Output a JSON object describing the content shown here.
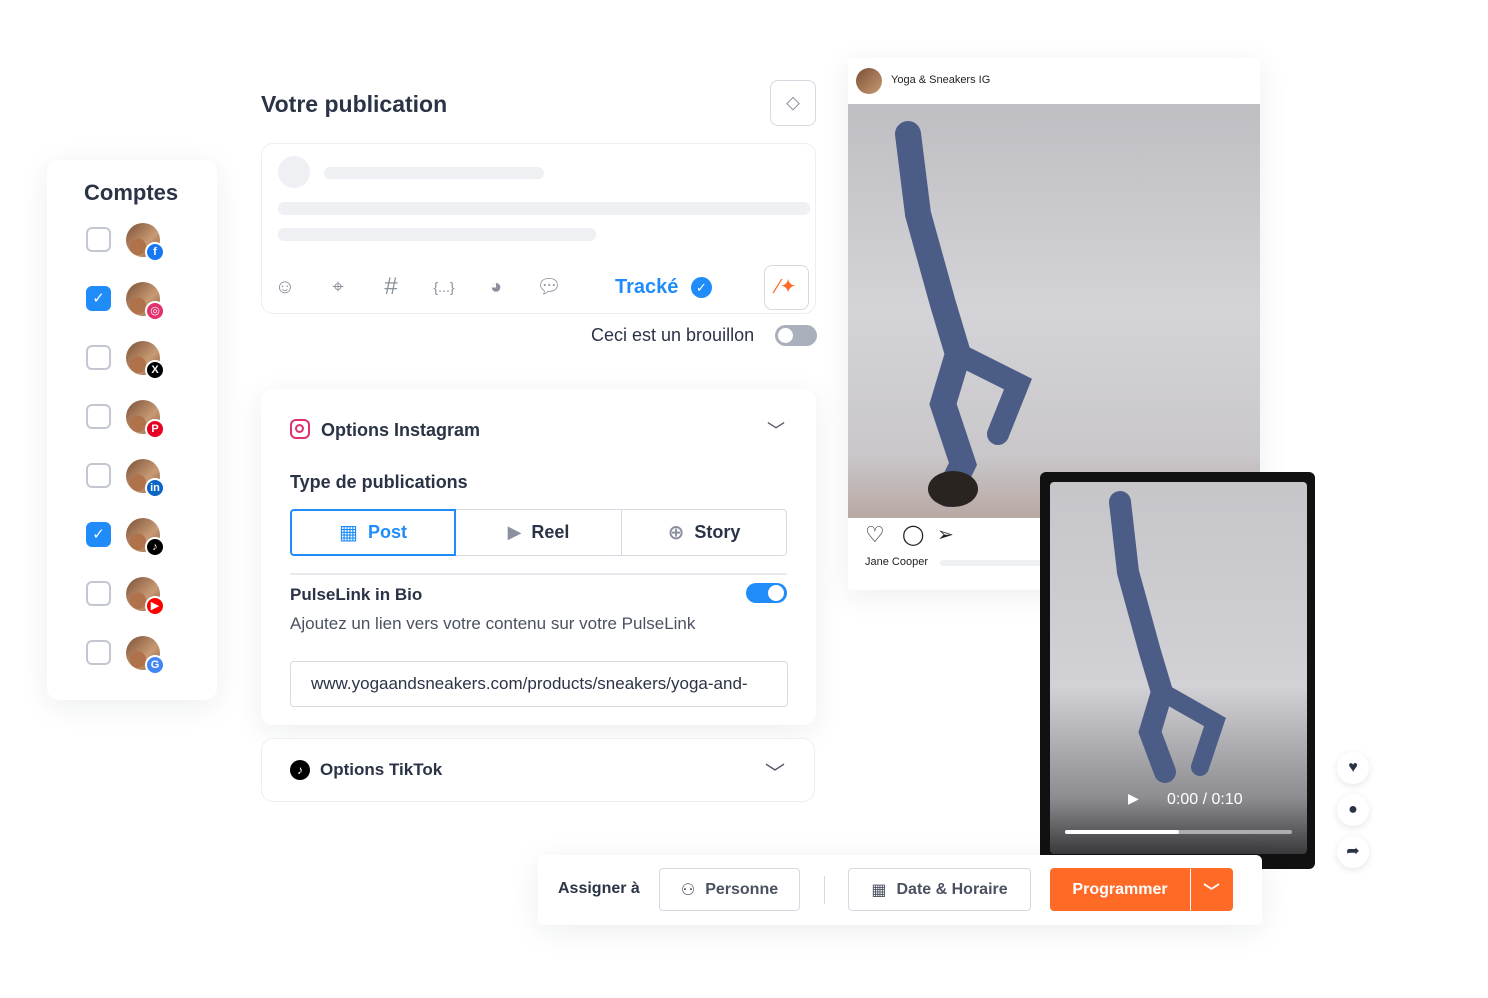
{
  "accounts": {
    "title": "Comptes",
    "items": [
      {
        "network": "facebook",
        "checked": false,
        "badge_color": "#1877f2",
        "glyph": "f"
      },
      {
        "network": "instagram",
        "checked": true,
        "badge_color": "#e1306c",
        "glyph": "◎"
      },
      {
        "network": "x",
        "checked": false,
        "badge_color": "#000000",
        "glyph": "X"
      },
      {
        "network": "pinterest",
        "checked": false,
        "badge_color": "#e60023",
        "glyph": "P"
      },
      {
        "network": "linkedin",
        "checked": false,
        "badge_color": "#0a66c2",
        "glyph": "in"
      },
      {
        "network": "tiktok",
        "checked": true,
        "badge_color": "#000000",
        "glyph": "♪"
      },
      {
        "network": "youtube",
        "checked": false,
        "badge_color": "#ff0000",
        "glyph": "▶"
      },
      {
        "network": "google-business",
        "checked": false,
        "badge_color": "#4285f4",
        "glyph": "G"
      }
    ]
  },
  "publication": {
    "title": "Votre publication",
    "tracked_label": "Tracké",
    "draft_label": "Ceci est un brouillon",
    "draft_on": false
  },
  "instagram": {
    "title": "Options Instagram",
    "type_label": "Type de publications",
    "types": [
      "Post",
      "Reel",
      "Story"
    ],
    "selected_type": "Post",
    "pulselink_title": "PulseLink in Bio",
    "pulselink_on": true,
    "pulselink_desc": "Ajoutez un lien vers votre contenu sur votre PulseLink",
    "url_value": "www.yogaandsneakers.com/products/sneakers/yoga-and-"
  },
  "tiktok": {
    "title": "Options TikTok"
  },
  "preview": {
    "account": "Yoga & Sneakers IG",
    "commenter": "Jane Cooper",
    "video_time": "0:00 / 0:10",
    "video_progress": 0.5
  },
  "bottom": {
    "assign_label": "Assigner à",
    "person_label": "Personne",
    "date_label": "Date & Horaire",
    "schedule_label": "Programmer"
  },
  "colors": {
    "accent": "#1f8cf9",
    "orange": "#ff6a27",
    "text": "#2b3346"
  }
}
